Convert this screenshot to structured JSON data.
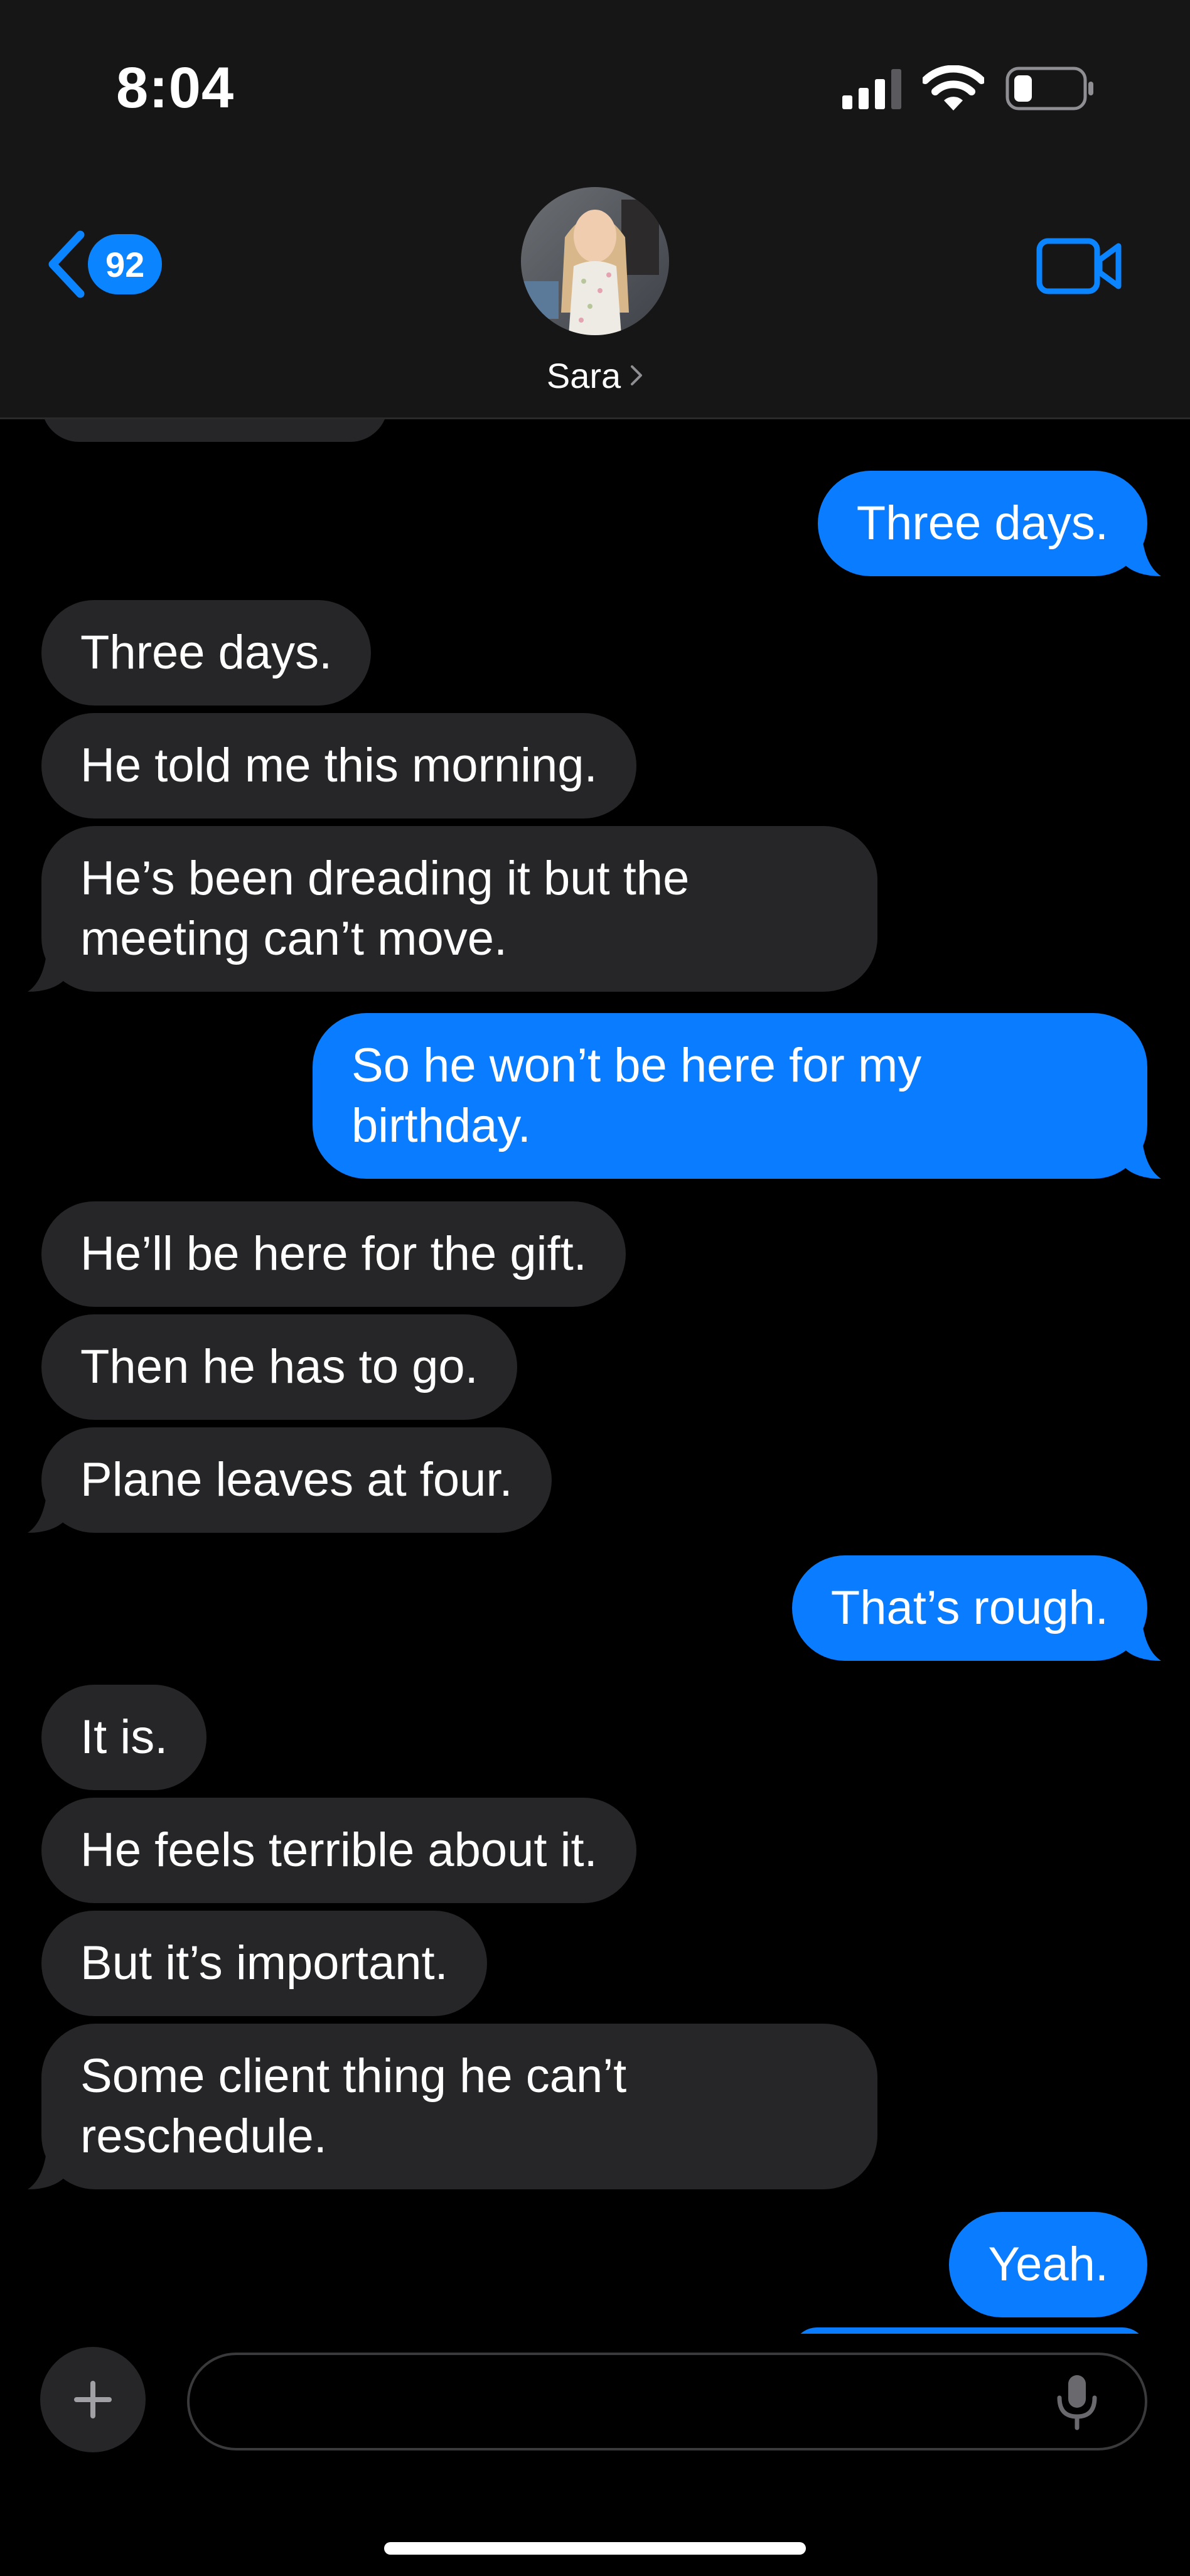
{
  "status_bar": {
    "time": "8:04",
    "signal_icon": "cellular-signal-icon",
    "wifi_icon": "wifi-icon",
    "battery_icon": "battery-low-icon"
  },
  "nav": {
    "back_icon": "chevron-left-icon",
    "unread_count": "92",
    "contact_name": "Sara",
    "contact_chevron_icon": "chevron-right-icon",
    "video_icon": "video-camera-icon",
    "accent_color": "#0a84ff"
  },
  "messages": [
    {
      "direction": "outgoing",
      "text": "Three days."
    },
    {
      "direction": "incoming",
      "text": "Three days."
    },
    {
      "direction": "incoming",
      "text": "He told me this morning."
    },
    {
      "direction": "incoming",
      "text": "He’s been dreading it but the\nmeeting can’t move."
    },
    {
      "direction": "outgoing",
      "text": "So he won’t be here for my\nbirthday."
    },
    {
      "direction": "incoming",
      "text": "He’ll be here for the gift."
    },
    {
      "direction": "incoming",
      "text": "Then he has to go."
    },
    {
      "direction": "incoming",
      "text": "Plane leaves at four."
    },
    {
      "direction": "outgoing",
      "text": "That’s rough."
    },
    {
      "direction": "incoming",
      "text": "It is."
    },
    {
      "direction": "incoming",
      "text": "He feels terrible about it."
    },
    {
      "direction": "incoming",
      "text": "But it’s important."
    },
    {
      "direction": "incoming",
      "text": "Some client thing he can’t\nreschedule."
    },
    {
      "direction": "outgoing",
      "text": "Yeah."
    }
  ],
  "colors": {
    "incoming_bubble": "#262628",
    "outgoing_bubble": "#0a7cff",
    "background": "#000000"
  },
  "input_bar": {
    "plus_icon": "plus-icon",
    "placeholder": "",
    "mic_icon": "microphone-icon"
  }
}
